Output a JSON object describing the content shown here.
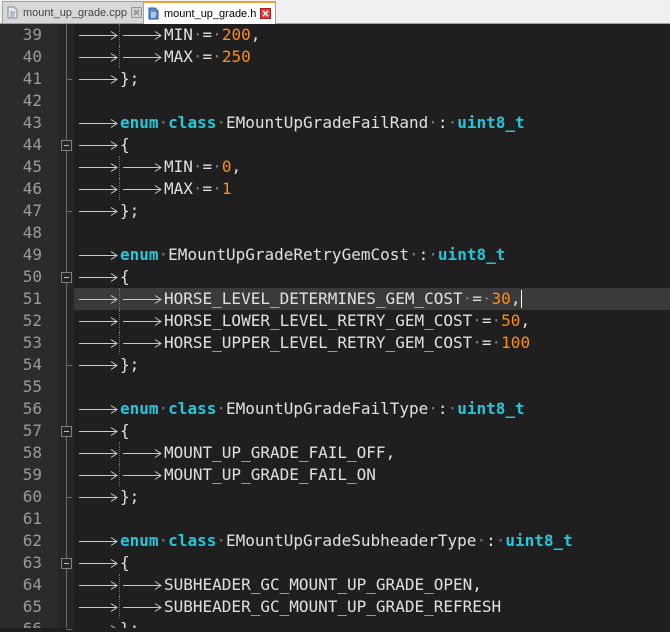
{
  "tabs": [
    {
      "label": "mount_up_grade.cpp",
      "active": false,
      "icon": "file-cpp-icon"
    },
    {
      "label": "mount_up_grade.h",
      "active": true,
      "icon": "file-h-icon"
    }
  ],
  "colors": {
    "keyword": "#26c6da",
    "number": "#ff8c1a",
    "identifier": "#e0e0e0",
    "whitespace_dot": "#7a7a7a",
    "line_number": "#9a9a9a",
    "background": "#1f1f1f",
    "current_line": "#3a3a3a",
    "active_tab_accent": "#f0a030"
  },
  "editor": {
    "current_line_number": "51",
    "lines": [
      {
        "no": "39",
        "indent": 2,
        "fold": "none",
        "tokens": [
          {
            "t": "MIN",
            "c": "id"
          },
          {
            "t": "·",
            "c": "dot"
          },
          {
            "t": "=",
            "c": "op"
          },
          {
            "t": "·",
            "c": "dot"
          },
          {
            "t": "200",
            "c": "num"
          },
          {
            "t": ",",
            "c": "op"
          }
        ]
      },
      {
        "no": "40",
        "indent": 2,
        "fold": "none",
        "tokens": [
          {
            "t": "MAX",
            "c": "id"
          },
          {
            "t": "·",
            "c": "dot"
          },
          {
            "t": "=",
            "c": "op"
          },
          {
            "t": "·",
            "c": "dot"
          },
          {
            "t": "250",
            "c": "num"
          }
        ]
      },
      {
        "no": "41",
        "indent": 1,
        "fold": "end",
        "tokens": [
          {
            "t": "};",
            "c": "op"
          }
        ]
      },
      {
        "no": "42",
        "indent": 0,
        "fold": "none",
        "tokens": []
      },
      {
        "no": "43",
        "indent": 1,
        "fold": "none",
        "tokens": [
          {
            "t": "enum",
            "c": "kw"
          },
          {
            "t": "·",
            "c": "dot"
          },
          {
            "t": "class",
            "c": "kw"
          },
          {
            "t": "·",
            "c": "dot"
          },
          {
            "t": "EMountUpGradeFailRand",
            "c": "id"
          },
          {
            "t": "·",
            "c": "dot"
          },
          {
            "t": ":",
            "c": "op"
          },
          {
            "t": "·",
            "c": "dot"
          },
          {
            "t": "uint8_t",
            "c": "kw"
          }
        ]
      },
      {
        "no": "44",
        "indent": 1,
        "fold": "start",
        "tokens": [
          {
            "t": "{",
            "c": "op"
          }
        ]
      },
      {
        "no": "45",
        "indent": 2,
        "fold": "none",
        "tokens": [
          {
            "t": "MIN",
            "c": "id"
          },
          {
            "t": "·",
            "c": "dot"
          },
          {
            "t": "=",
            "c": "op"
          },
          {
            "t": "·",
            "c": "dot"
          },
          {
            "t": "0",
            "c": "num"
          },
          {
            "t": ",",
            "c": "op"
          }
        ]
      },
      {
        "no": "46",
        "indent": 2,
        "fold": "none",
        "tokens": [
          {
            "t": "MAX",
            "c": "id"
          },
          {
            "t": "·",
            "c": "dot"
          },
          {
            "t": "=",
            "c": "op"
          },
          {
            "t": "·",
            "c": "dot"
          },
          {
            "t": "1",
            "c": "num"
          }
        ]
      },
      {
        "no": "47",
        "indent": 1,
        "fold": "end",
        "tokens": [
          {
            "t": "};",
            "c": "op"
          }
        ]
      },
      {
        "no": "48",
        "indent": 0,
        "fold": "none",
        "tokens": []
      },
      {
        "no": "49",
        "indent": 1,
        "fold": "none",
        "tokens": [
          {
            "t": "enum",
            "c": "kw"
          },
          {
            "t": "·",
            "c": "dot"
          },
          {
            "t": "EMountUpGradeRetryGemCost",
            "c": "id"
          },
          {
            "t": "·",
            "c": "dot"
          },
          {
            "t": ":",
            "c": "op"
          },
          {
            "t": "·",
            "c": "dot"
          },
          {
            "t": "uint8_t",
            "c": "kw"
          }
        ]
      },
      {
        "no": "50",
        "indent": 1,
        "fold": "start",
        "tokens": [
          {
            "t": "{",
            "c": "op"
          }
        ]
      },
      {
        "no": "51",
        "indent": 2,
        "fold": "none",
        "tokens": [
          {
            "t": "HORSE_LEVEL_DETERMINES_GEM_COST",
            "c": "id"
          },
          {
            "t": "·",
            "c": "dot"
          },
          {
            "t": "=",
            "c": "op"
          },
          {
            "t": "·",
            "c": "dot"
          },
          {
            "t": "30",
            "c": "num"
          },
          {
            "t": ",",
            "c": "op"
          }
        ]
      },
      {
        "no": "52",
        "indent": 2,
        "fold": "none",
        "tokens": [
          {
            "t": "HORSE_LOWER_LEVEL_RETRY_GEM_COST",
            "c": "id"
          },
          {
            "t": "·",
            "c": "dot"
          },
          {
            "t": "=",
            "c": "op"
          },
          {
            "t": "·",
            "c": "dot"
          },
          {
            "t": "50",
            "c": "num"
          },
          {
            "t": ",",
            "c": "op"
          }
        ]
      },
      {
        "no": "53",
        "indent": 2,
        "fold": "none",
        "tokens": [
          {
            "t": "HORSE_UPPER_LEVEL_RETRY_GEM_COST",
            "c": "id"
          },
          {
            "t": "·",
            "c": "dot"
          },
          {
            "t": "=",
            "c": "op"
          },
          {
            "t": "·",
            "c": "dot"
          },
          {
            "t": "100",
            "c": "num"
          }
        ]
      },
      {
        "no": "54",
        "indent": 1,
        "fold": "end",
        "tokens": [
          {
            "t": "};",
            "c": "op"
          }
        ]
      },
      {
        "no": "55",
        "indent": 0,
        "fold": "none",
        "tokens": []
      },
      {
        "no": "56",
        "indent": 1,
        "fold": "none",
        "tokens": [
          {
            "t": "enum",
            "c": "kw"
          },
          {
            "t": "·",
            "c": "dot"
          },
          {
            "t": "class",
            "c": "kw"
          },
          {
            "t": "·",
            "c": "dot"
          },
          {
            "t": "EMountUpGradeFailType",
            "c": "id"
          },
          {
            "t": "·",
            "c": "dot"
          },
          {
            "t": ":",
            "c": "op"
          },
          {
            "t": "·",
            "c": "dot"
          },
          {
            "t": "uint8_t",
            "c": "kw"
          }
        ]
      },
      {
        "no": "57",
        "indent": 1,
        "fold": "start",
        "tokens": [
          {
            "t": "{",
            "c": "op"
          }
        ]
      },
      {
        "no": "58",
        "indent": 2,
        "fold": "none",
        "tokens": [
          {
            "t": "MOUNT_UP_GRADE_FAIL_OFF",
            "c": "id"
          },
          {
            "t": ",",
            "c": "op"
          }
        ]
      },
      {
        "no": "59",
        "indent": 2,
        "fold": "none",
        "tokens": [
          {
            "t": "MOUNT_UP_GRADE_FAIL_ON",
            "c": "id"
          }
        ]
      },
      {
        "no": "60",
        "indent": 1,
        "fold": "end",
        "tokens": [
          {
            "t": "};",
            "c": "op"
          }
        ]
      },
      {
        "no": "61",
        "indent": 0,
        "fold": "none",
        "tokens": []
      },
      {
        "no": "62",
        "indent": 1,
        "fold": "none",
        "tokens": [
          {
            "t": "enum",
            "c": "kw"
          },
          {
            "t": "·",
            "c": "dot"
          },
          {
            "t": "class",
            "c": "kw"
          },
          {
            "t": "·",
            "c": "dot"
          },
          {
            "t": "EMountUpGradeSubheaderType",
            "c": "id"
          },
          {
            "t": "·",
            "c": "dot"
          },
          {
            "t": ":",
            "c": "op"
          },
          {
            "t": "·",
            "c": "dot"
          },
          {
            "t": "uint8_t",
            "c": "kw"
          }
        ]
      },
      {
        "no": "63",
        "indent": 1,
        "fold": "start",
        "tokens": [
          {
            "t": "{",
            "c": "op"
          }
        ]
      },
      {
        "no": "64",
        "indent": 2,
        "fold": "none",
        "tokens": [
          {
            "t": "SUBHEADER_GC_MOUNT_UP_GRADE_OPEN",
            "c": "id"
          },
          {
            "t": ",",
            "c": "op"
          }
        ]
      },
      {
        "no": "65",
        "indent": 2,
        "fold": "none",
        "tokens": [
          {
            "t": "SUBHEADER_GC_MOUNT_UP_GRADE_REFRESH",
            "c": "id"
          }
        ]
      },
      {
        "no": "66",
        "indent": 1,
        "fold": "end",
        "tokens": [
          {
            "t": "};",
            "c": "op"
          }
        ]
      }
    ]
  }
}
